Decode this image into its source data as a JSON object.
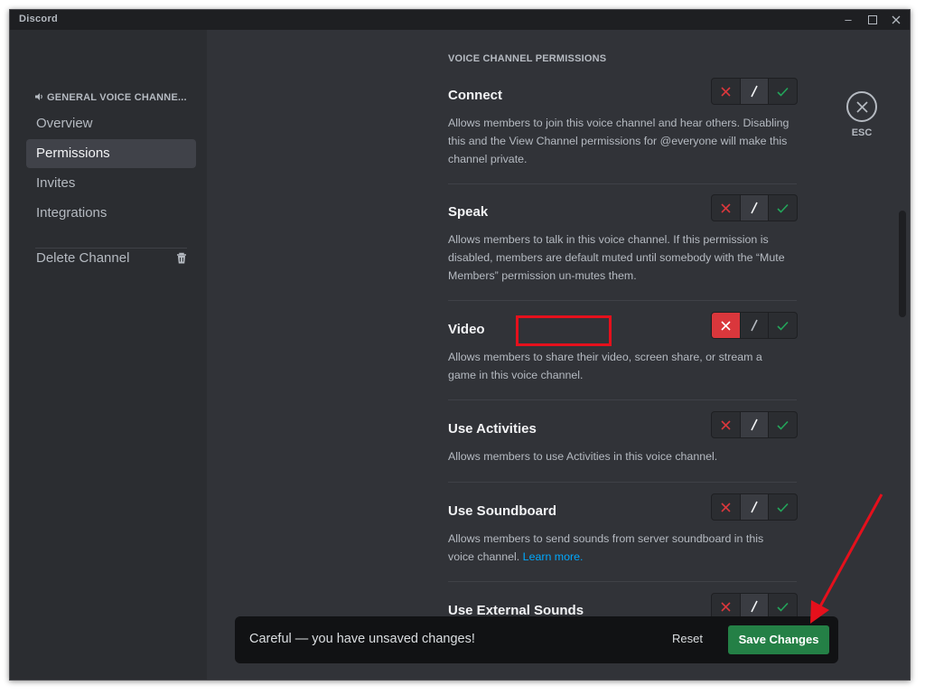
{
  "window": {
    "app_title": "Discord"
  },
  "sidebar": {
    "header": "GENERAL VOICE CHANNE...",
    "items": [
      {
        "label": "Overview"
      },
      {
        "label": "Permissions",
        "active": true
      },
      {
        "label": "Invites"
      },
      {
        "label": "Integrations"
      }
    ],
    "delete_label": "Delete Channel"
  },
  "main": {
    "section_title": "VOICE CHANNEL PERMISSIONS",
    "permissions": [
      {
        "name": "Connect",
        "description": "Allows members to join this voice channel and hear others. Disabling this and the View Channel permissions for @everyone will make this channel private.",
        "state": "neutral"
      },
      {
        "name": "Speak",
        "description": "Allows members to talk in this voice channel. If this permission is disabled, members are default muted until somebody with the “Mute Members” permission un-mutes them.",
        "state": "neutral"
      },
      {
        "name": "Video",
        "description": "Allows members to share their video, screen share, or stream a game in this voice channel.",
        "state": "deny"
      },
      {
        "name": "Use Activities",
        "description": "Allows members to use Activities in this voice channel.",
        "state": "neutral"
      },
      {
        "name": "Use Soundboard",
        "description": "Allows members to send sounds from server soundboard in this voice channel.",
        "link": "Learn more.",
        "state": "neutral"
      },
      {
        "name": "Use External Sounds",
        "description": "",
        "state": "neutral"
      }
    ]
  },
  "esc": {
    "label": "ESC"
  },
  "unsaved_bar": {
    "message": "Careful — you have unsaved changes!",
    "reset_label": "Reset",
    "save_label": "Save Changes"
  },
  "colors": {
    "background": "#313338",
    "sidebar": "#2b2d31",
    "deny": "#da373c",
    "allow": "#23a55a",
    "save": "#248046",
    "highlight": "#e5101c"
  }
}
